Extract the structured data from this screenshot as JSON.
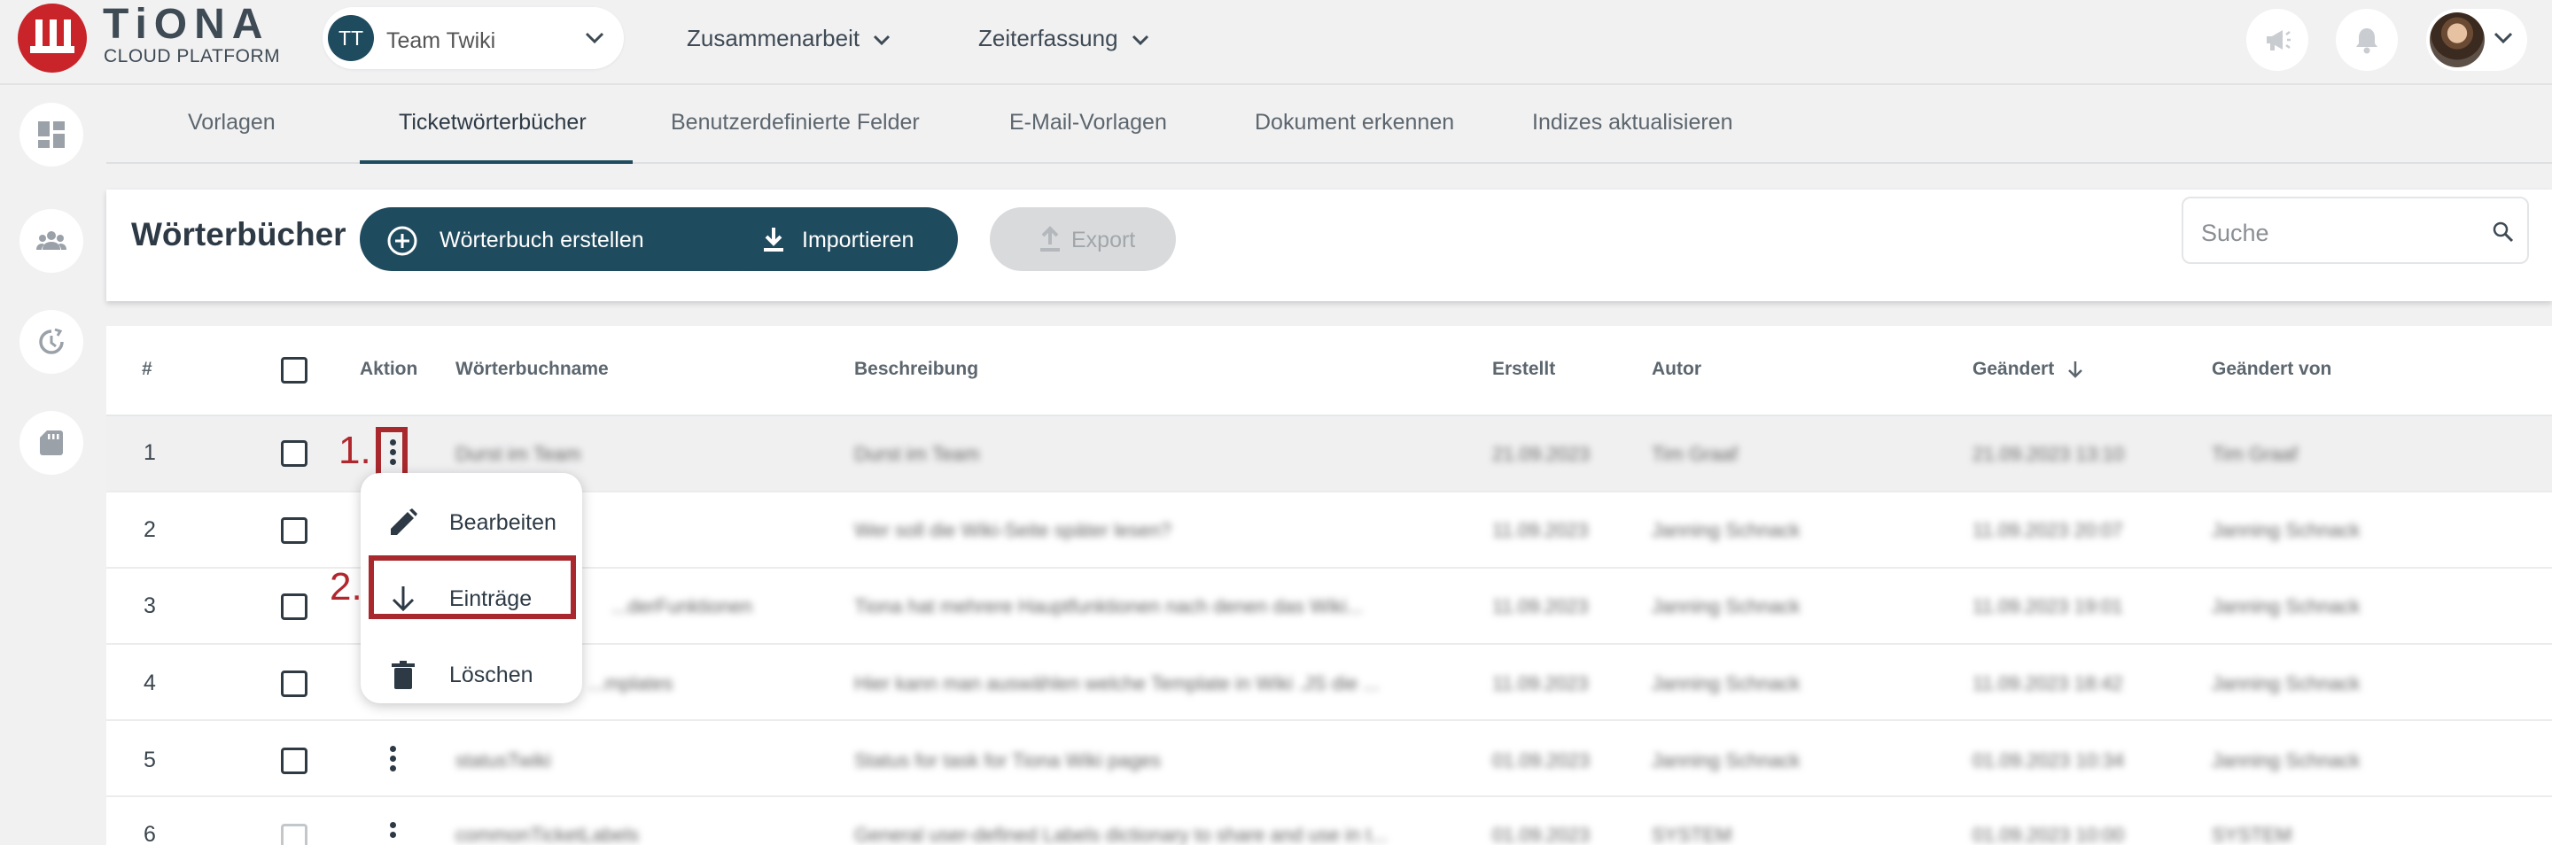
{
  "app": {
    "logo_name": "TiONA",
    "logo_sub": "CLOUD PLATFORM"
  },
  "team": {
    "initials": "TT",
    "name": "Team Twiki"
  },
  "nav": {
    "collab": "Zusammenarbeit",
    "time": "Zeiterfassung"
  },
  "tabs": [
    {
      "label": "Vorlagen"
    },
    {
      "label": "Ticketwörterbücher"
    },
    {
      "label": "Benutzerdefinierte Felder"
    },
    {
      "label": "E-Mail-Vorlagen"
    },
    {
      "label": "Dokument erkennen"
    },
    {
      "label": "Indizes aktualisieren"
    }
  ],
  "toolbar": {
    "title": "Wörterbücher",
    "create_label": "Wörterbuch erstellen",
    "import_label": "Importieren",
    "export_label": "Export",
    "search_placeholder": "Suche"
  },
  "table": {
    "columns": [
      "#",
      "Aktion",
      "Wörterbuchname",
      "Beschreibung",
      "Erstellt",
      "Autor",
      "Geändert",
      "Geändert von"
    ],
    "rows": [
      {
        "num": "1",
        "name": "Durst im Team",
        "desc": "Durst im Team",
        "created": "21.09.2023",
        "author": "Tim Graaf",
        "modified": "21.09.2023 13:10",
        "modified_by": "Tim Graaf"
      },
      {
        "num": "2",
        "name": "",
        "desc": "Wer soll die Wiki-Seite später lesen?",
        "created": "11.09.2023",
        "author": "Janning Schnack",
        "modified": "11.09.2023 20:07",
        "modified_by": "Janning Schnack"
      },
      {
        "num": "3",
        "name": "...derFunktionen",
        "desc": "Tiona hat mehrere Hauptfunktionen nach denen das Wiki...",
        "created": "11.09.2023",
        "author": "Janning Schnack",
        "modified": "11.09.2023 19:01",
        "modified_by": "Janning Schnack"
      },
      {
        "num": "4",
        "name": "...mplates",
        "desc": "Hier kann man auswählen welche Template in Wiki .JS die ...",
        "created": "11.09.2023",
        "author": "Janning Schnack",
        "modified": "11.09.2023 18:42",
        "modified_by": "Janning Schnack"
      },
      {
        "num": "5",
        "name": "statusTwiki",
        "desc": "Status for task for Tiona Wiki pages",
        "created": "01.09.2023",
        "author": "Janning Schnack",
        "modified": "01.09.2023 10:34",
        "modified_by": "Janning Schnack"
      },
      {
        "num": "6",
        "name": "commonTicketLabels",
        "desc": "General user-defined Labels dictionary to share and use in t...",
        "created": "01.09.2023",
        "author": "SYSTEM",
        "modified": "01.09.2023 10:00",
        "modified_by": "SYSTEM"
      }
    ]
  },
  "annotations": {
    "step1": "1.",
    "step2": "2."
  },
  "context_menu": {
    "edit": "Bearbeiten",
    "entries": "Einträge",
    "delete": "Löschen"
  },
  "colors": {
    "brand_red": "#c8242a",
    "primary": "#1f4b5e",
    "annotation_red": "#a8282d"
  }
}
